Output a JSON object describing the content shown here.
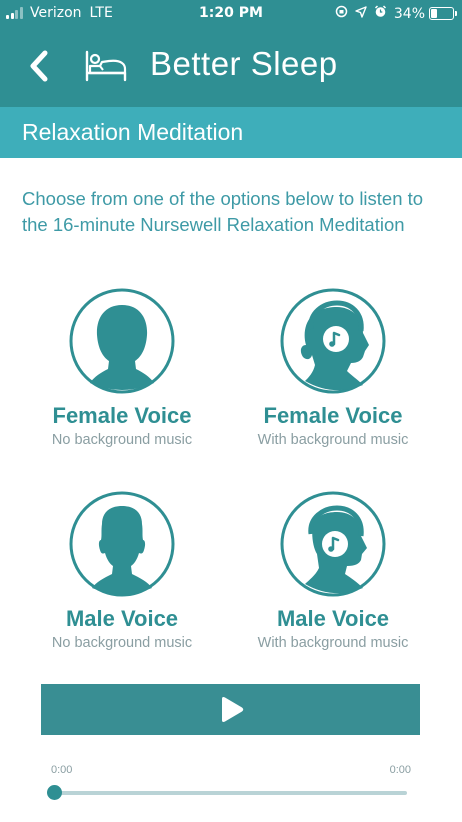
{
  "status_bar": {
    "carrier": "Verizon",
    "network": "LTE",
    "time": "1:20 PM",
    "battery": "34%",
    "battery_level": 0.34
  },
  "nav": {
    "title": "Better Sleep",
    "back_icon": "chevron-left-icon",
    "app_icon": "bed-icon"
  },
  "section": {
    "title": "Relaxation Meditation"
  },
  "intro": "Choose from one of the options below to listen to the 16-minute Nursewell Relaxation Meditation",
  "options": [
    {
      "title": "Female Voice",
      "subtitle": "No background music",
      "icon": "female-silhouette-icon"
    },
    {
      "title": "Female Voice",
      "subtitle": "With background music",
      "icon": "female-headphones-icon"
    },
    {
      "title": "Male Voice",
      "subtitle": "No background music",
      "icon": "male-silhouette-icon"
    },
    {
      "title": "Male Voice",
      "subtitle": "With background music",
      "icon": "male-headphones-icon"
    }
  ],
  "player": {
    "current_time": "0:00",
    "duration": "0:00",
    "progress": 0
  },
  "colors": {
    "header": "#2f8f93",
    "section_bar": "#3eaeba",
    "accent": "#2f8f93",
    "text_intro": "#3e9aa6",
    "subtitle": "#8a9ea2"
  }
}
